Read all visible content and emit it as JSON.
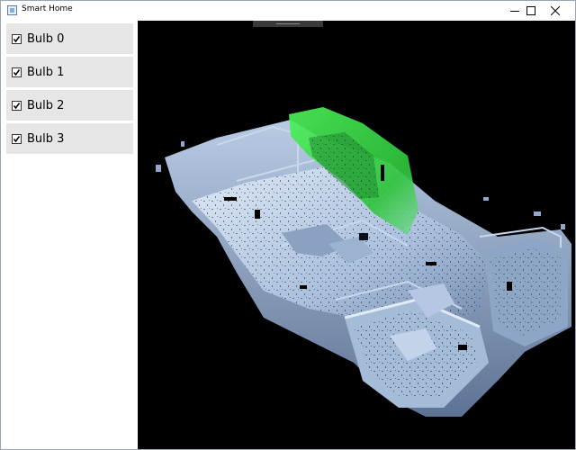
{
  "window": {
    "title": "Smart Home",
    "icons": {
      "app": "app-window-icon",
      "minimize": "minimize-icon",
      "maximize": "maximize-icon",
      "close": "close-icon"
    }
  },
  "sidebar": {
    "items": [
      {
        "label": "Bulb 0",
        "checked": true
      },
      {
        "label": "Bulb 1",
        "checked": true
      },
      {
        "label": "Bulb 2",
        "checked": true
      },
      {
        "label": "Bulb 3",
        "checked": true
      }
    ]
  },
  "viewport": {
    "background": "#000000",
    "scan_color": "#9fb8d8",
    "highlight_color": "#39e64a"
  }
}
